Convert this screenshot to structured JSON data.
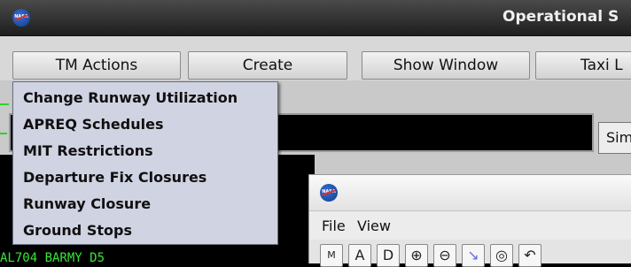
{
  "window": {
    "title": "Operational S"
  },
  "toolbar": {
    "buttons": [
      {
        "label": "TM Actions"
      },
      {
        "label": "Create"
      },
      {
        "label": "Show Window"
      },
      {
        "label": "Taxi L"
      }
    ]
  },
  "tm_actions_menu": {
    "items": [
      {
        "label": "Change Runway Utilization"
      },
      {
        "label": "APREQ Schedules"
      },
      {
        "label": "MIT Restrictions"
      },
      {
        "label": "Departure Fix Closures"
      },
      {
        "label": "Runway Closure"
      },
      {
        "label": "Ground Stops"
      }
    ]
  },
  "sim_field": {
    "text": "Sim"
  },
  "scope": {
    "flight_label": "AL704 BARMY D5"
  },
  "sub_window": {
    "menus": [
      {
        "label": "File"
      },
      {
        "label": "View"
      }
    ],
    "tools": [
      {
        "glyph": "M",
        "icon": "map-select-icon"
      },
      {
        "glyph": "A",
        "icon": "letter-a-icon"
      },
      {
        "glyph": "D",
        "icon": "letter-d-icon"
      },
      {
        "glyph": "⊕",
        "icon": "zoom-in-icon"
      },
      {
        "glyph": "⊖",
        "icon": "zoom-out-icon"
      },
      {
        "glyph": "↘",
        "icon": "route-icon"
      },
      {
        "glyph": "◎",
        "icon": "target-icon"
      },
      {
        "glyph": "↶",
        "icon": "rotate-icon"
      }
    ]
  },
  "colors": {
    "menu_background": "#cfd3e2",
    "scope_text": "#39e639",
    "titlebar": "#2a2a2a"
  }
}
